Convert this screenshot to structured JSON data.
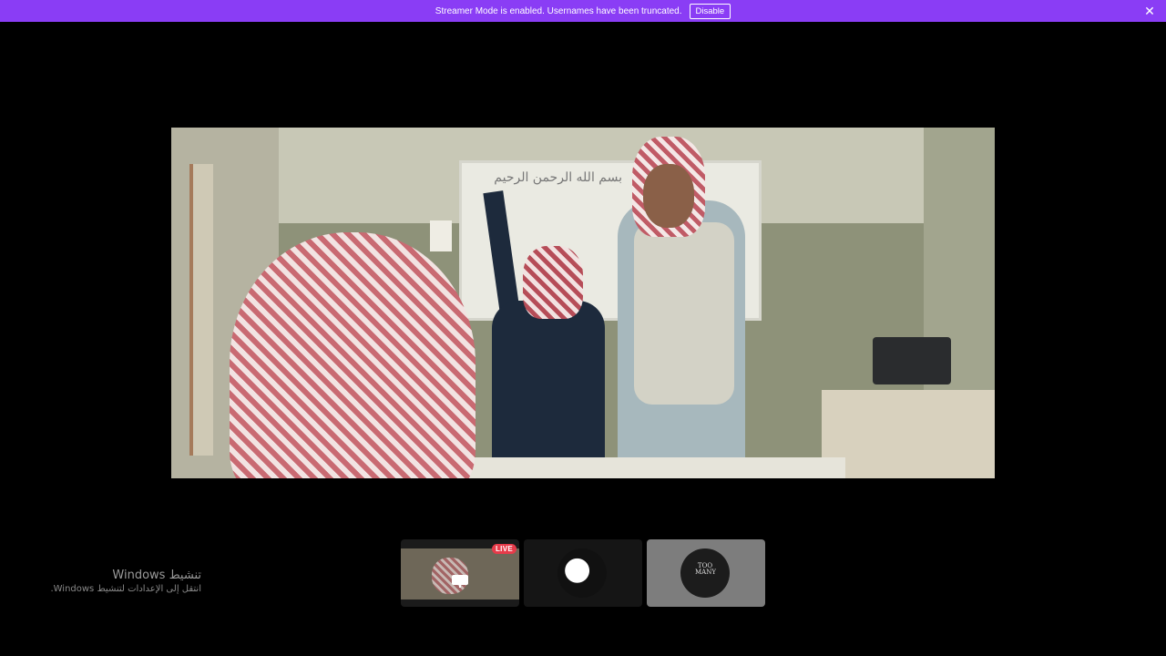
{
  "banner": {
    "message": "Streamer Mode is enabled. Usernames have been truncated.",
    "disable_label": "Disable",
    "close_icon": "close-icon",
    "color": "#8a3df5"
  },
  "main_stream": {
    "board_text": "بسم الله الرحمن الرحيم"
  },
  "thumbnails": [
    {
      "type": "screen-share",
      "badge": "LIVE",
      "icon": "screen-share-icon"
    },
    {
      "type": "avatar",
      "icon": "avatar"
    },
    {
      "type": "avatar",
      "icon": "avatar",
      "text": "TOO MANY"
    }
  ],
  "watermark": {
    "title": "تنشيط Windows",
    "subtitle": "انتقل إلى الإعدادات لتنشيط Windows."
  },
  "colors": {
    "live_badge": "#e63b4a",
    "background": "#000000"
  }
}
